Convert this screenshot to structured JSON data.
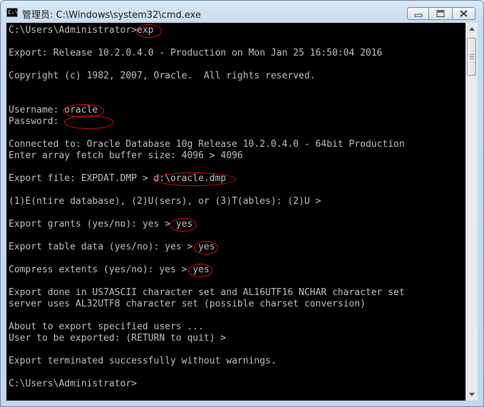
{
  "window": {
    "title": "管理员: C:\\Windows\\system32\\cmd.exe",
    "icon_label": "C:\\",
    "buttons": [
      "minimize-icon",
      "maximize-icon",
      "close-icon"
    ]
  },
  "console": {
    "text_color": "#c0c0c0",
    "background": "#000000",
    "annotation_color": "#e01010",
    "lines": [
      "C:\\Users\\Administrator>exp",
      "",
      "Export: Release 10.2.0.4.0 - Production on Mon Jan 25 16:50:04 2016",
      "",
      "Copyright (c) 1982, 2007, Oracle.  All rights reserved.",
      "",
      "",
      "Username: oracle",
      "Password:",
      "",
      "Connected to: Oracle Database 10g Release 10.2.0.4.0 - 64bit Production",
      "Enter array fetch buffer size: 4096 > 4096",
      "",
      "Export file: EXPDAT.DMP > d:\\oracle.dmp",
      "",
      "(1)E(ntire database), (2)U(sers), or (3)T(ables): (2)U >",
      "",
      "Export grants (yes/no): yes > yes",
      "",
      "Export table data (yes/no): yes > yes",
      "",
      "Compress extents (yes/no): yes > yes",
      "",
      "Export done in US7ASCII character set and AL16UTF16 NCHAR character set",
      "server uses AL32UTF8 character set (possible charset conversion)",
      "",
      "About to export specified users ...",
      "User to be exported: (RETURN to quit) >",
      "",
      "Export terminated successfully without warnings.",
      "",
      "C:\\Users\\Administrator>"
    ]
  }
}
